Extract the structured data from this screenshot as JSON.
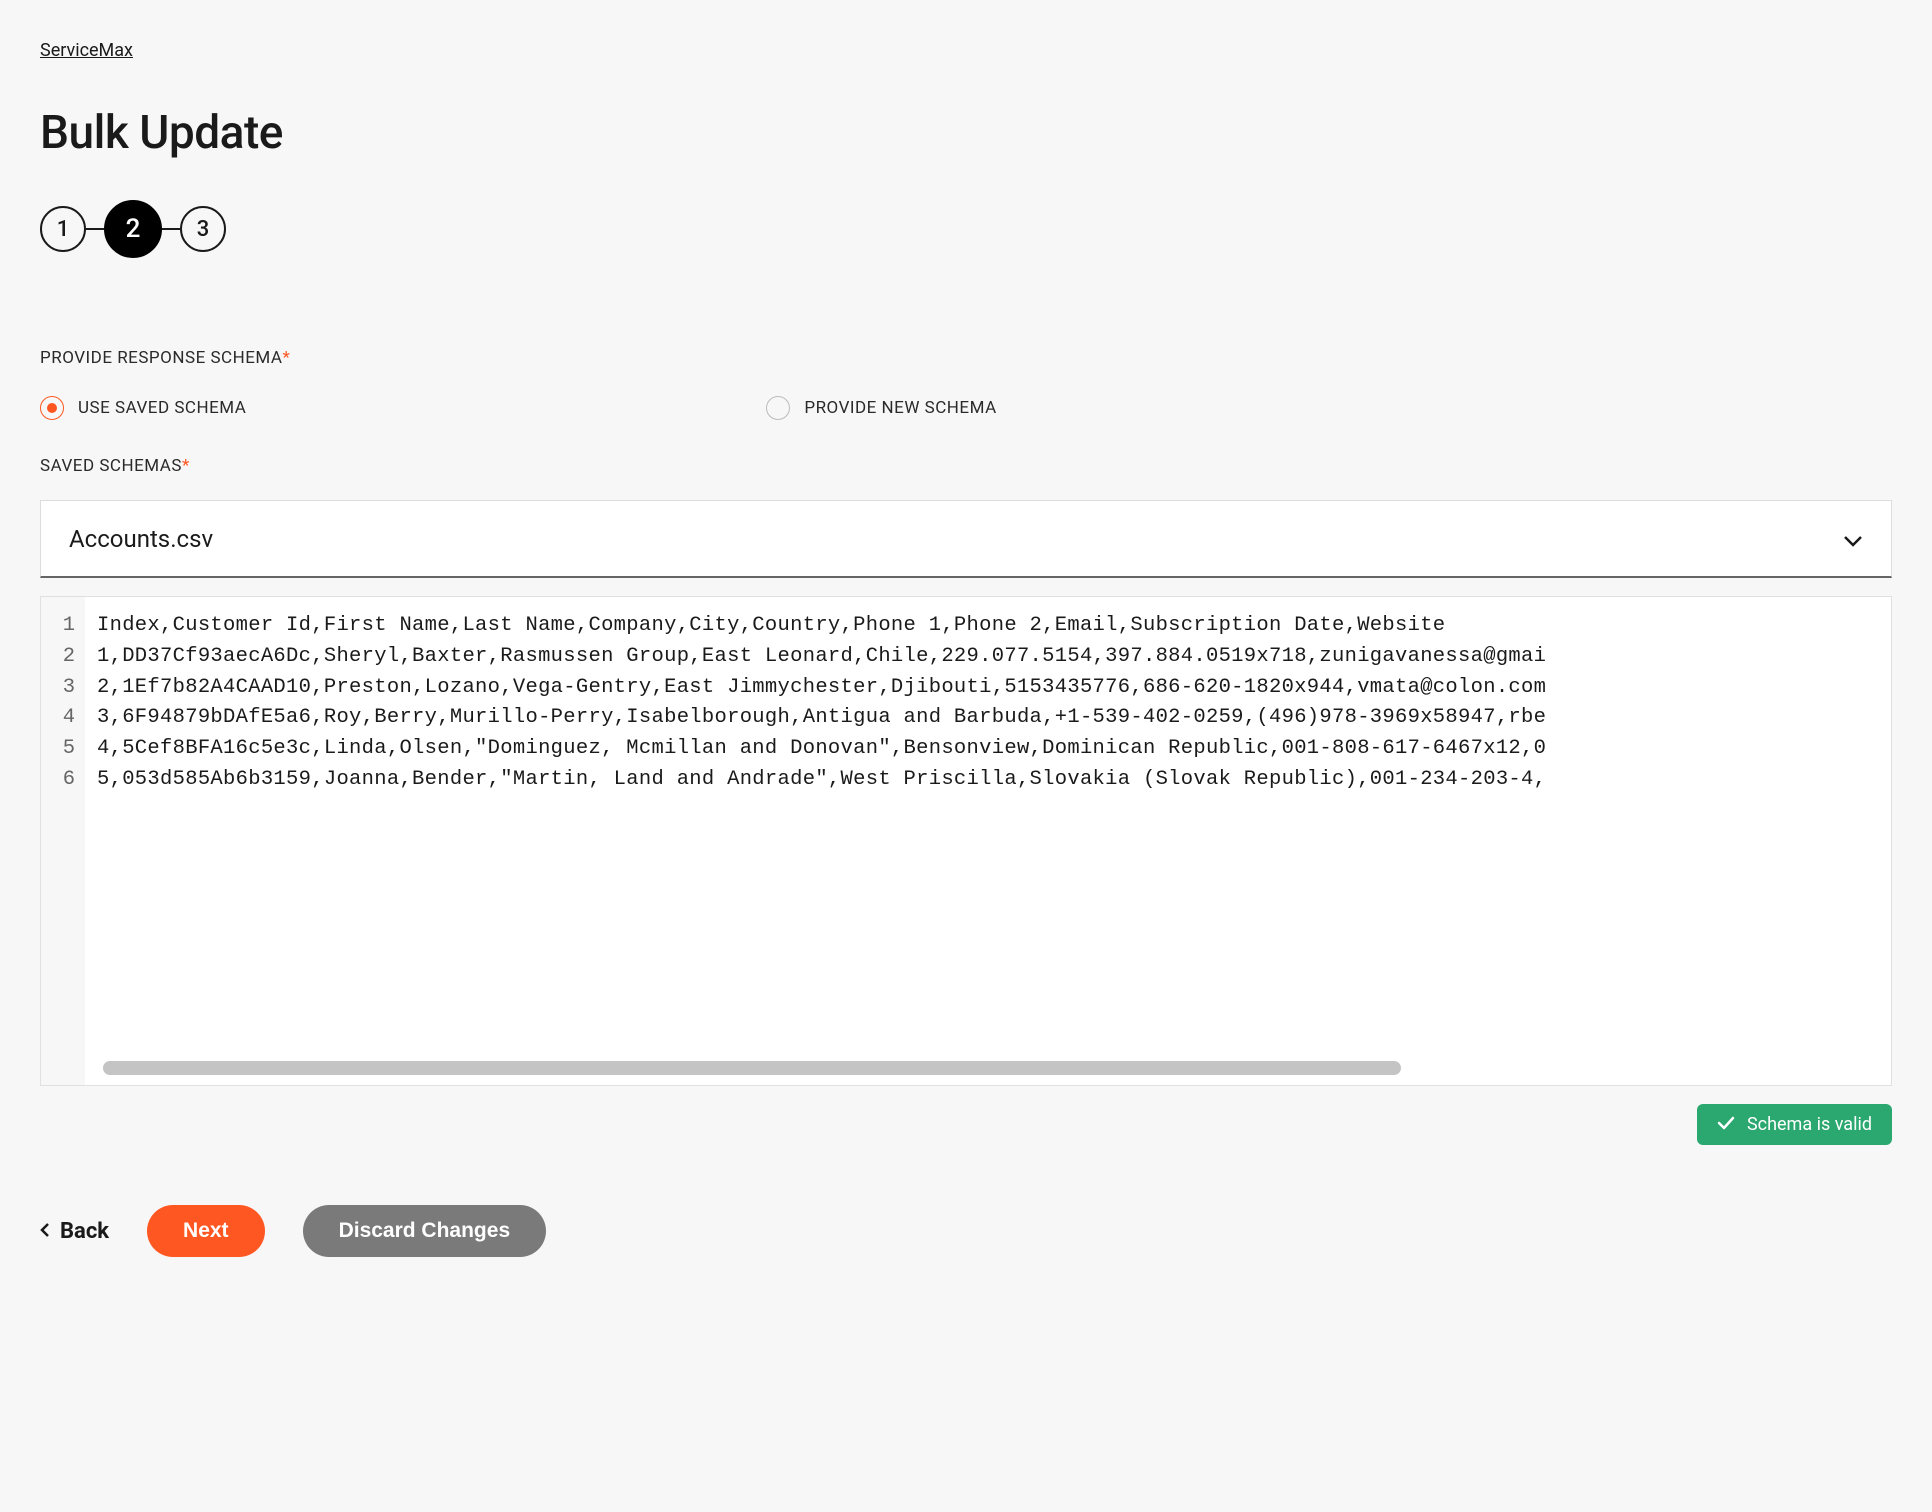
{
  "breadcrumb": "ServiceMax",
  "page_title": "Bulk Update",
  "stepper": {
    "steps": [
      "1",
      "2",
      "3"
    ],
    "active_index": 1
  },
  "schema_section": {
    "label": "PROVIDE RESPONSE SCHEMA",
    "radio_options": {
      "use_saved": "USE SAVED SCHEMA",
      "provide_new": "PROVIDE NEW SCHEMA",
      "selected": "use_saved"
    },
    "saved_schemas_label": "SAVED SCHEMAS",
    "selected_schema": "Accounts.csv"
  },
  "code_lines": [
    "Index,Customer Id,First Name,Last Name,Company,City,Country,Phone 1,Phone 2,Email,Subscription Date,Website",
    "1,DD37Cf93aecA6Dc,Sheryl,Baxter,Rasmussen Group,East Leonard,Chile,229.077.5154,397.884.0519x718,zunigavanessa@gmai",
    "2,1Ef7b82A4CAAD10,Preston,Lozano,Vega-Gentry,East Jimmychester,Djibouti,5153435776,686-620-1820x944,vmata@colon.com",
    "3,6F94879bDAfE5a6,Roy,Berry,Murillo-Perry,Isabelborough,Antigua and Barbuda,+1-539-402-0259,(496)978-3969x58947,rbe",
    "4,5Cef8BFA16c5e3c,Linda,Olsen,\"Dominguez, Mcmillan and Donovan\",Bensonview,Dominican Republic,001-808-617-6467x12,0",
    "5,053d585Ab6b3159,Joanna,Bender,\"Martin, Land and Andrade\",West Priscilla,Slovakia (Slovak Republic),001-234-203-4,"
  ],
  "validation": {
    "message": "Schema is valid"
  },
  "footer": {
    "back": "Back",
    "next": "Next",
    "discard": "Discard Changes"
  }
}
